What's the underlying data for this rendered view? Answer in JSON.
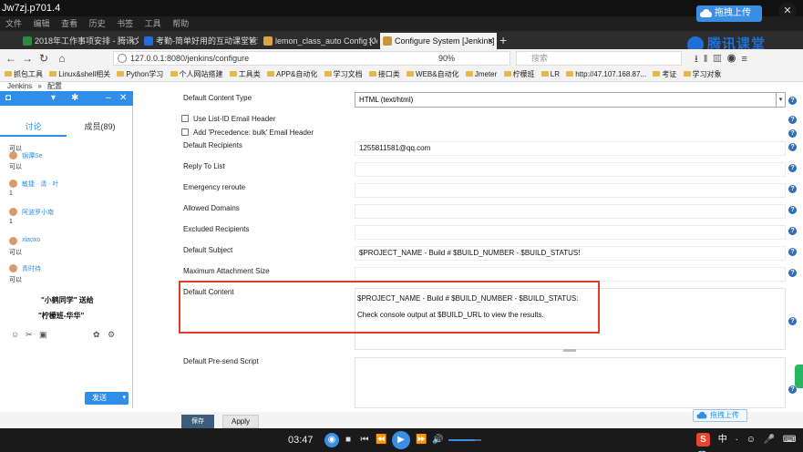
{
  "player": {
    "title": "Jw7zj.p701.4",
    "time": "03:47",
    "volume_fraction": 0.8
  },
  "menubar": {
    "items": [
      "文件",
      "编辑",
      "查看",
      "历史",
      "书签",
      "工具",
      "帮助"
    ]
  },
  "tabs": [
    {
      "label": "2018年工作事项安排 - 腾讯文",
      "active": false,
      "icon_color": "#2b8a3e"
    },
    {
      "label": "考勤-简单好用的互动课堂管理",
      "active": false,
      "icon_color": "#1f6fd6"
    },
    {
      "label": "lemon_class_auto Config [Je",
      "active": false,
      "icon_color": "#d9a441"
    },
    {
      "label": "Configure System [Jenkins]",
      "active": true,
      "icon_color": "#c9953b"
    }
  ],
  "overlay": {
    "upload_label": "拖拽上传",
    "brand": "腾讯课堂",
    "close_label": "✕"
  },
  "navbar": {
    "url": "127.0.0.1:8080/jenkins/configure",
    "zoom": "90%",
    "search_placeholder": "搜索"
  },
  "bookmarks": [
    "抓包工具",
    "Linux&shell相关",
    "Python学习",
    "个人网站搭建",
    "工具类",
    "APP&自动化",
    "学习文档",
    "接口类",
    "WEB&自动化",
    "Jmeter",
    "柠檬班",
    "LR",
    "http://47.107.168.87...",
    "考证",
    "学习对象"
  ],
  "breadcrumb": {
    "root": "Jenkins",
    "separator": "»",
    "current": "配置"
  },
  "jenkins": {
    "content_type_label": "Default Content Type",
    "content_type_value": "HTML (text/html)",
    "list_id_label": "Use List-ID Email Header",
    "precedence_label": "Add 'Precedence: bulk' Email Header",
    "recipients_label": "Default Recipients",
    "recipients_value": "1255811581@qq.com",
    "reply_to_label": "Reply To List",
    "emergency_label": "Emergency reroute",
    "allowed_domains_label": "Allowed Domains",
    "excluded_label": "Excluded Recipients",
    "subject_label": "Default Subject",
    "subject_value": "$PROJECT_NAME - Build # $BUILD_NUMBER - $BUILD_STATUS!",
    "max_attach_label": "Maximum Attachment Size",
    "content_label": "Default Content",
    "content_line1": "$PROJECT_NAME - Build # $BUILD_NUMBER - $BUILD_STATUS:",
    "content_line2": "Check console output at $BUILD_URL to view the results.",
    "presend_label": "Default Pre-send Script",
    "help_glyph": "?",
    "save_label": "保存",
    "apply_label": "Apply",
    "highlight_color": "#e53b2c"
  },
  "chat": {
    "tab_discuss": "讨论",
    "tab_members": "成员(89)",
    "messages": [
      {
        "name": "",
        "text": "可以"
      },
      {
        "name": "锅谭Se",
        "text": "可以"
      },
      {
        "name": "敏捷 · 清 · 叶",
        "text": "1"
      },
      {
        "name": "阿波罗小南",
        "text": "1"
      },
      {
        "name": "xiaoxo",
        "text": "可以"
      },
      {
        "name": "青时待",
        "text": "可以"
      }
    ],
    "gift_line1": "\"小鹤同学\" 送给",
    "gift_line2": "\"柠檬班-华华\"",
    "send_label": "发送"
  },
  "tray": {
    "logo": "S",
    "items": [
      "中",
      "·",
      "☺",
      "🎤",
      "⌨",
      "👕",
      "⋯"
    ]
  }
}
